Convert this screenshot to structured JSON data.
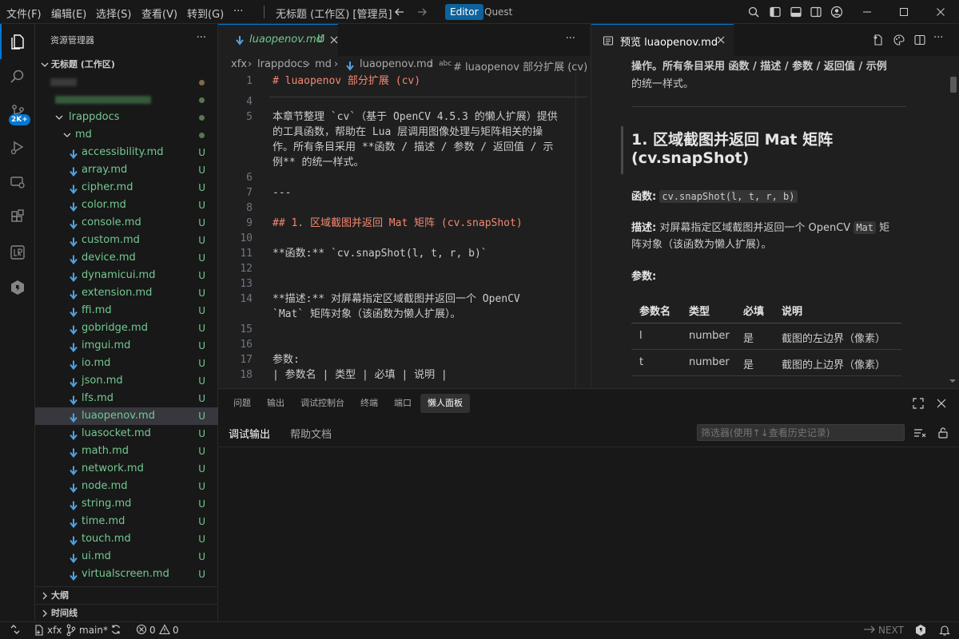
{
  "menu": [
    "文件(F)",
    "编辑(E)",
    "选择(S)",
    "查看(V)",
    "转到(G)",
    "···"
  ],
  "window_title": "无标题 (工作区) [管理员]",
  "modes": {
    "editor": "Editor",
    "quest": "Quest"
  },
  "activity": {
    "badge": "2K+"
  },
  "explorer": {
    "title": "资源管理器",
    "more": "···",
    "workspace": "无标题 (工作区)",
    "folder": "lrappdocs",
    "subfolder": "md",
    "status_u": "U",
    "files": [
      "accessibility.md",
      "array.md",
      "cipher.md",
      "color.md",
      "console.md",
      "custom.md",
      "device.md",
      "dynamicui.md",
      "extension.md",
      "ffi.md",
      "gobridge.md",
      "imgui.md",
      "io.md",
      "json.md",
      "lfs.md",
      "luaopenov.md",
      "luasocket.md",
      "math.md",
      "network.md",
      "node.md",
      "string.md",
      "time.md",
      "touch.md",
      "ui.md",
      "virtualscreen.md"
    ],
    "selected": "luaopenov.md",
    "outline": "大纲",
    "timeline": "时间线"
  },
  "editor": {
    "tab_label": "luaopenov.md",
    "tab_status": "U",
    "more": "···",
    "breadcrumb": [
      "xfx",
      "lrappdocs",
      "md",
      "luaopenov.md",
      "# luaopenov 部分扩展 (cv)"
    ],
    "lines": [
      {
        "n": "1",
        "t": "# luaopenov 部分扩展 (cv)",
        "c": "#f48771"
      },
      {
        "n": "4",
        "t": "",
        "c": "#cccccc"
      },
      {
        "n": "5",
        "t": "本章节整理 `cv`（基于 OpenCV 4.5.3 的懒人扩展）提供",
        "c": "#cccccc"
      },
      {
        "n": "",
        "t": "的工具函数，帮助在 Lua 层调用图像处理与矩阵相关的操",
        "c": "#cccccc"
      },
      {
        "n": "",
        "t": "作。所有条目采用 **函数 / 描述 / 参数 / 返回值 / 示",
        "c": "#cccccc"
      },
      {
        "n": "",
        "t": "例** 的统一样式。",
        "c": "#cccccc"
      },
      {
        "n": "6",
        "t": "",
        "c": "#cccccc"
      },
      {
        "n": "7",
        "t": "---",
        "c": "#cccccc"
      },
      {
        "n": "8",
        "t": "",
        "c": "#cccccc"
      },
      {
        "n": "9",
        "t": "## 1. 区域截图并返回 Mat 矩阵 (cv.snapShot)",
        "c": "#f48771"
      },
      {
        "n": "10",
        "t": "",
        "c": "#cccccc"
      },
      {
        "n": "11",
        "t": "**函数:** `cv.snapShot(l, t, r, b)`",
        "c": "#cccccc"
      },
      {
        "n": "12",
        "t": "",
        "c": "#cccccc"
      },
      {
        "n": "13",
        "t": "",
        "c": "#cccccc"
      },
      {
        "n": "14",
        "t": "**描述:** 对屏幕指定区域截图并返回一个 OpenCV",
        "c": "#cccccc"
      },
      {
        "n": "",
        "t": "`Mat` 矩阵对象（该函数为懒人扩展）。",
        "c": "#cccccc"
      },
      {
        "n": "15",
        "t": "",
        "c": "#cccccc"
      },
      {
        "n": "16",
        "t": "",
        "c": "#cccccc"
      },
      {
        "n": "17",
        "t": "参数:",
        "c": "#cccccc"
      },
      {
        "n": "18",
        "t": "| 参数名 | 类型 | 必填 | 说明 |",
        "c": "#cccccc"
      }
    ]
  },
  "preview": {
    "tab_label": "预览 luaopenov.md",
    "intro_1": "操作。所有条目采用 函数 / 描述 / 参数 / 返回值 / 示例",
    "intro_2": "的统一样式。",
    "heading_1": "1. 区域截图并返回 Mat 矩阵",
    "heading_2": "(cv.snapShot)",
    "func_label": "函数:",
    "func_code": "cv.snapShot(l, t, r, b)",
    "desc_label": "描述:",
    "desc_text_a": "对屏幕指定区域截图并返回一个 OpenCV",
    "desc_code": "Mat",
    "desc_text_b": "矩",
    "desc_text_c": "阵对象（该函数为懒人扩展）。",
    "params_label": "参数:",
    "table": {
      "headers": [
        "参数名",
        "类型",
        "必填",
        "说明"
      ],
      "rows": [
        [
          "l",
          "number",
          "是",
          "截图的左边界（像素）"
        ],
        [
          "t",
          "number",
          "是",
          "截图的上边界（像素）"
        ]
      ]
    }
  },
  "panel": {
    "tabs": [
      "问题",
      "输出",
      "调试控制台",
      "终端",
      "端口",
      "懒人面板"
    ],
    "active_tab": "懒人面板",
    "subtabs": [
      "调试输出",
      "帮助文档"
    ],
    "filter_placeholder": "筛选器(使用↑↓查看历史记录)"
  },
  "status": {
    "remote": "xfx",
    "branch": "main*",
    "errors": "0",
    "warnings": "0",
    "next": "NEXT"
  }
}
